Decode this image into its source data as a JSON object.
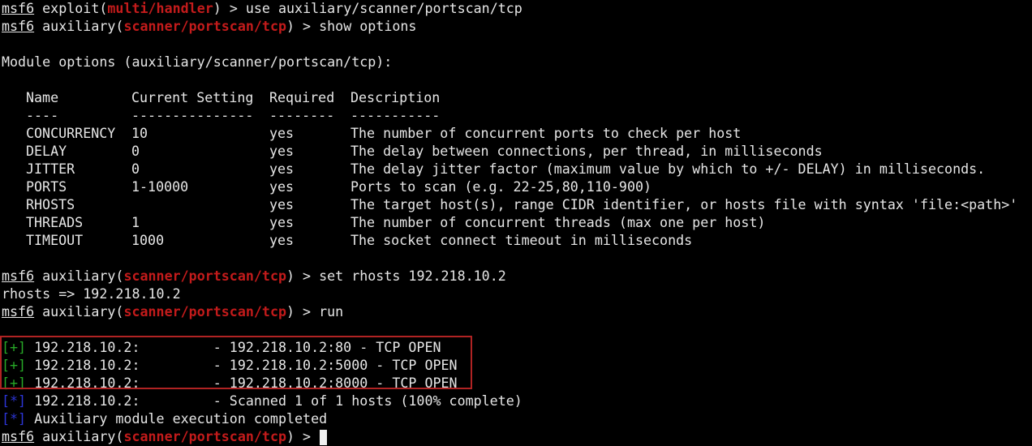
{
  "prompt_name": "msf6",
  "history": {
    "l1_pre": " exploit(",
    "l1_module": "multi/handler",
    "l1_post": ") > use auxiliary/scanner/portscan/tcp",
    "l2_pre": " auxiliary(",
    "l2_module": "scanner/portscan/tcp",
    "l2_post": ") > show options"
  },
  "module_options_title": "Module options (auxiliary/scanner/portscan/tcp):",
  "options_table": {
    "headers": [
      "Name",
      "Current Setting",
      "Required",
      "Description"
    ],
    "underlines": [
      "----",
      "---------------",
      "--------",
      "-----------"
    ],
    "rows": [
      {
        "name": "CONCURRENCY",
        "setting": "10",
        "required": "yes",
        "description": "The number of concurrent ports to check per host"
      },
      {
        "name": "DELAY",
        "setting": "0",
        "required": "yes",
        "description": "The delay between connections, per thread, in milliseconds"
      },
      {
        "name": "JITTER",
        "setting": "0",
        "required": "yes",
        "description": "The delay jitter factor (maximum value by which to +/- DELAY) in milliseconds."
      },
      {
        "name": "PORTS",
        "setting": "1-10000",
        "required": "yes",
        "description": "Ports to scan (e.g. 22-25,80,110-900)"
      },
      {
        "name": "RHOSTS",
        "setting": "",
        "required": "yes",
        "description": "The target host(s), range CIDR identifier, or hosts file with syntax 'file:<path>'"
      },
      {
        "name": "THREADS",
        "setting": "1",
        "required": "yes",
        "description": "The number of concurrent threads (max one per host)"
      },
      {
        "name": "TIMEOUT",
        "setting": "1000",
        "required": "yes",
        "description": "The socket connect timeout in milliseconds"
      }
    ]
  },
  "commands": {
    "set_pre": " auxiliary(",
    "set_module": "scanner/portscan/tcp",
    "set_post": ") > set rhosts 192.218.10.2",
    "set_result": "rhosts => 192.218.10.2",
    "run_pre": " auxiliary(",
    "run_module": "scanner/portscan/tcp",
    "run_post": ") > run"
  },
  "results": [
    {
      "tag": "[+]",
      "text": " 192.218.10.2:         - 192.218.10.2:80 - TCP OPEN"
    },
    {
      "tag": "[+]",
      "text": " 192.218.10.2:         - 192.218.10.2:5000 - TCP OPEN"
    },
    {
      "tag": "[+]",
      "text": " 192.218.10.2:         - 192.218.10.2:8000 - TCP OPEN"
    },
    {
      "tag": "[*]",
      "text": " 192.218.10.2:         - Scanned 1 of 1 hosts (100% complete)"
    },
    {
      "tag": "[*]",
      "text": " Auxiliary module execution completed"
    }
  ],
  "final_prompt": {
    "pre": " auxiliary(",
    "module": "scanner/portscan/tcp",
    "post": ") > "
  },
  "colors": {
    "background": "#000000",
    "text": "#e6e6e6",
    "module_red": "#c31b1b",
    "success_green": "#27a827",
    "info_blue": "#2c35d6",
    "highlight_box": "#b02323"
  }
}
